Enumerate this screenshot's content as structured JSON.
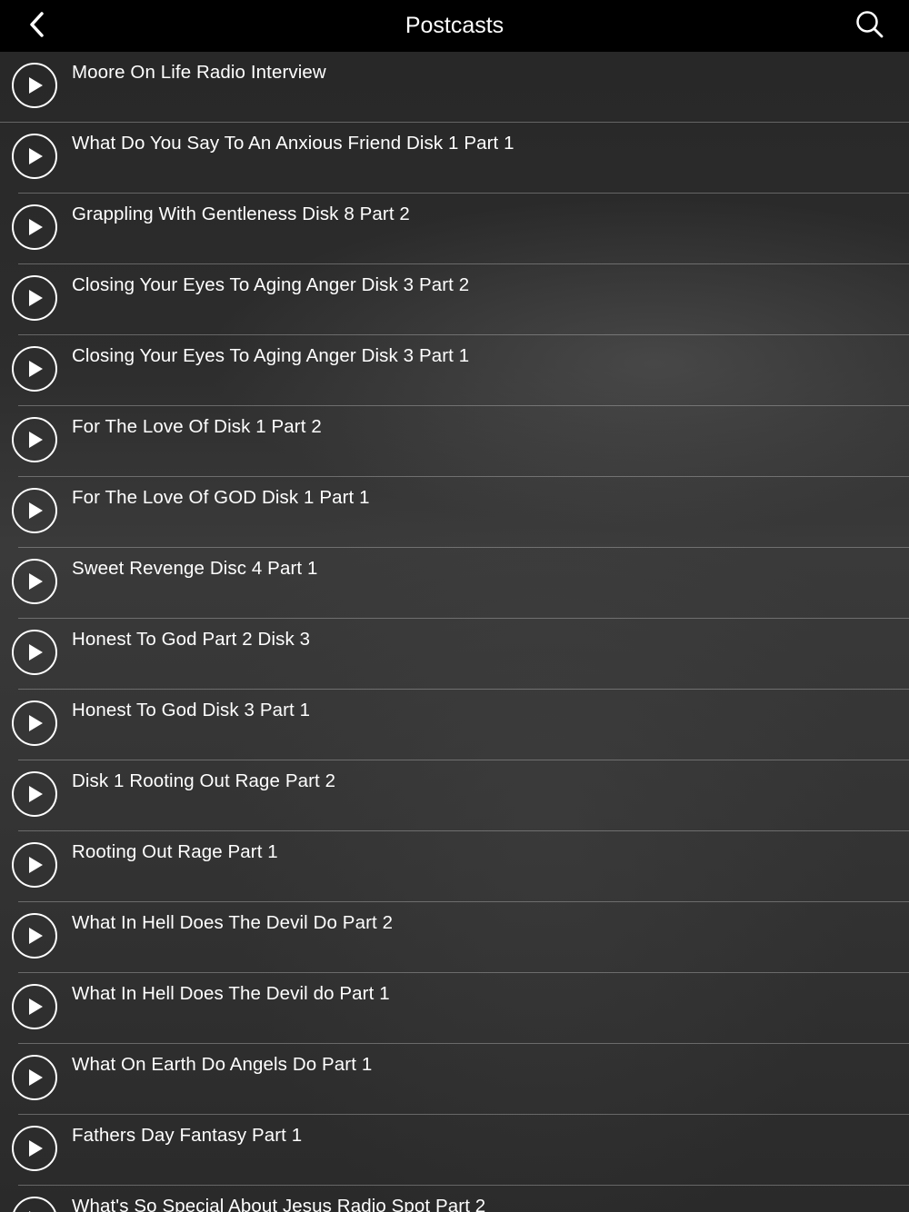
{
  "header": {
    "title": "Postcasts",
    "back_icon": "chevron-left-icon",
    "search_icon": "search-icon"
  },
  "podcasts": [
    {
      "title": "Moore On Life Radio Interview"
    },
    {
      "title": "What Do You Say To An Anxious Friend Disk 1 Part 1"
    },
    {
      "title": "Grappling With Gentleness Disk 8 Part 2"
    },
    {
      "title": "Closing Your Eyes To Aging Anger Disk 3 Part 2"
    },
    {
      "title": "Closing Your Eyes To Aging Anger Disk 3 Part 1"
    },
    {
      "title": "For The Love Of Disk 1 Part 2"
    },
    {
      "title": "For The Love Of GOD Disk 1 Part 1"
    },
    {
      "title": "Sweet Revenge Disc 4 Part 1"
    },
    {
      "title": "Honest To God Part 2 Disk 3"
    },
    {
      "title": "Honest To God Disk 3 Part 1"
    },
    {
      "title": "Disk 1 Rooting Out Rage Part 2"
    },
    {
      "title": "Rooting Out Rage Part 1"
    },
    {
      "title": "What In Hell Does The Devil Do Part 2"
    },
    {
      "title": "What In Hell Does The Devil do Part 1"
    },
    {
      "title": "What On Earth Do Angels Do Part 1"
    },
    {
      "title": "Fathers Day Fantasy Part 1"
    },
    {
      "title": "What's So Special About Jesus Radio Spot Part 2"
    }
  ],
  "colors": {
    "navbar": "#000000",
    "text": "#ffffff",
    "background": "#2b2b2b"
  }
}
